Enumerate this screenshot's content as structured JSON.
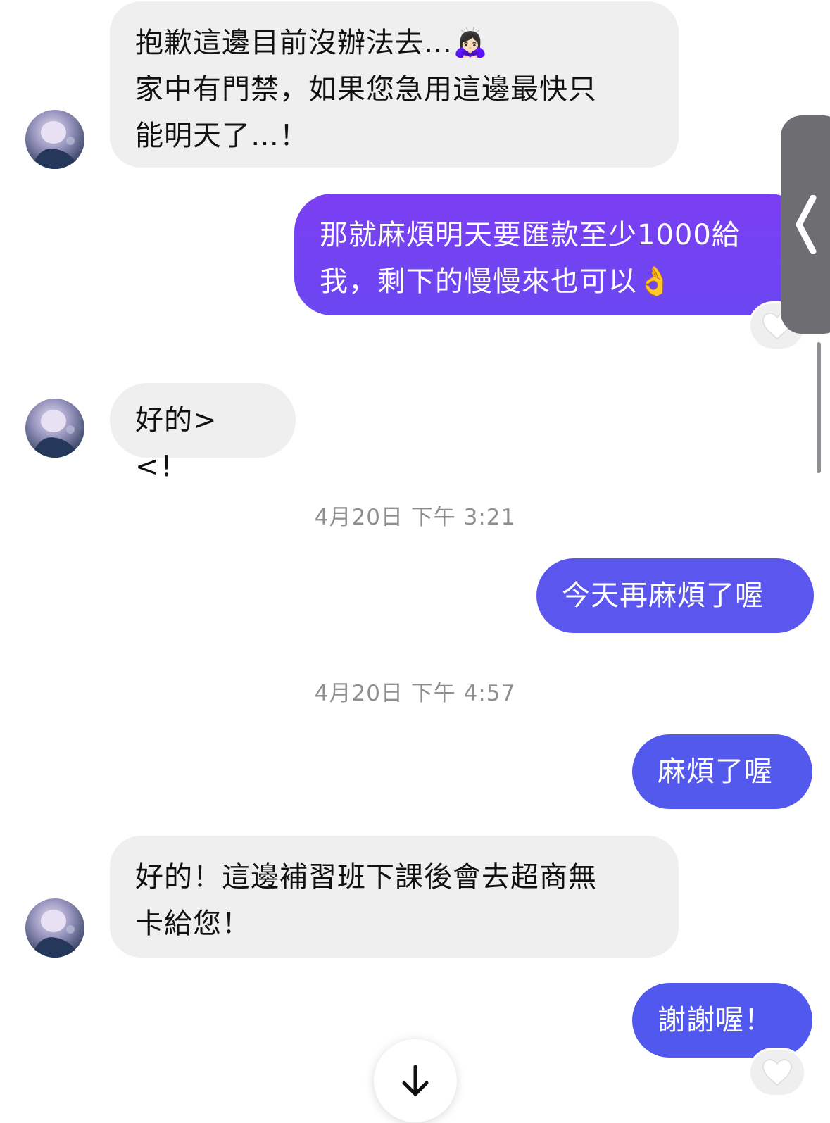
{
  "colors": {
    "incoming_bubble": "#efefef",
    "outgoing_gradient_top": "#7b3ff2",
    "outgoing_gradient_bottom": "#4f5af0",
    "outgoing_solid": "#5459ee",
    "timestamp_text": "#8e8e8e"
  },
  "messages": [
    {
      "direction": "incoming",
      "text": "抱歉這邊目前沒辦法去…🙇🏻‍♀️\n家中有門禁，如果您急用這邊最快只\n能明天了…！"
    },
    {
      "direction": "outgoing",
      "text": "那就麻煩明天要匯款至少1000給\n我，剩下的慢慢來也可以👌",
      "reaction": "heart-icon"
    },
    {
      "direction": "incoming",
      "text": "好的><！"
    },
    {
      "direction": "outgoing",
      "text": "今天再麻煩了喔"
    },
    {
      "direction": "outgoing",
      "text": "麻煩了喔"
    },
    {
      "direction": "incoming",
      "text": "好的！這邊補習班下課後會去超商無\n卡給您！"
    },
    {
      "direction": "outgoing",
      "text": "謝謝喔！",
      "reaction": "heart-icon"
    }
  ],
  "timestamps": [
    "4月20日 下午 3:21",
    "4月20日 下午 4:57"
  ],
  "icons": {
    "edge_tab": "chevron-left-icon",
    "scroll_button": "arrow-down-icon",
    "reaction": "heart-icon",
    "avatar": "avatar"
  }
}
